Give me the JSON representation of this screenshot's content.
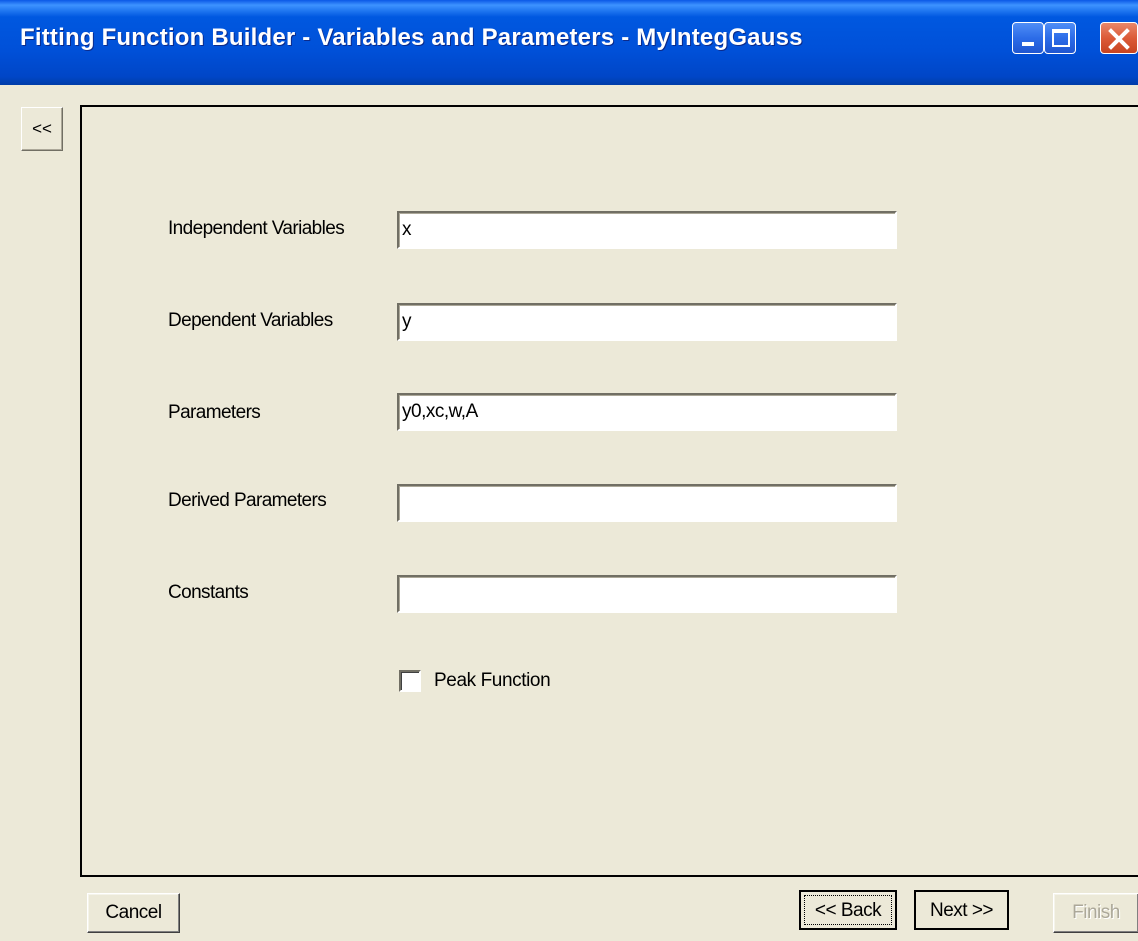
{
  "window": {
    "title": "Fitting Function Builder - Variables and Parameters - MyIntegGauss"
  },
  "side": {
    "collapse_label": "<<"
  },
  "form": {
    "independent_label": "Independent Variables",
    "independent_value": "x",
    "dependent_label": "Dependent Variables",
    "dependent_value": "y",
    "parameters_label": "Parameters",
    "parameters_value": "y0,xc,w,A",
    "derived_label": "Derived Parameters",
    "derived_value": "",
    "constants_label": "Constants",
    "constants_value": "",
    "peak_label": "Peak Function",
    "peak_checked": false
  },
  "buttons": {
    "cancel": "Cancel",
    "back": "<< Back",
    "next": "Next >>",
    "finish": "Finish"
  },
  "colors": {
    "title_bar": "#0058e0",
    "dialog_bg": "#ece9d8",
    "close_button": "#dc5b38",
    "disabled_text": "#aca899"
  }
}
